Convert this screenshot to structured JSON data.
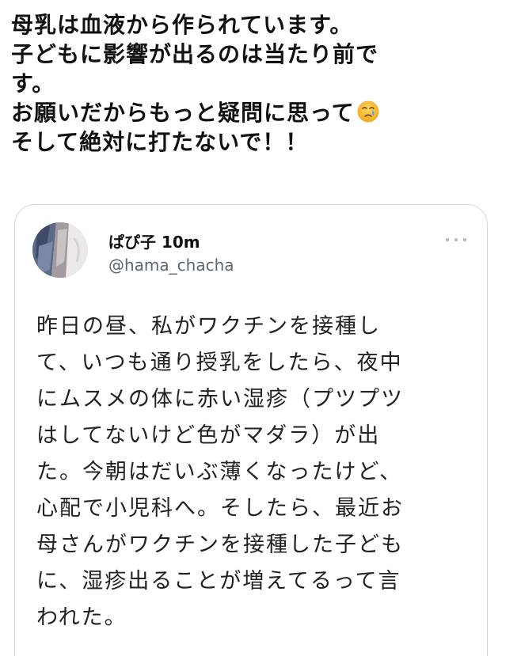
{
  "main_tweet": {
    "lines": [
      "母乳は血液から作られています。",
      "子どもに影響が出るのは当たり前で",
      "す。",
      "お願いだからもっと疑問に思って",
      "そして絶対に打たないで！！"
    ],
    "emoji": "crying-face-emoji"
  },
  "quote": {
    "author_name": "ぱぴ子 10m",
    "handle": "@hama_chacha",
    "lines": [
      "昨日の昼、私がワクチンを接種し",
      "て、いつも通り授乳をしたら、夜中",
      "にムスメの体に赤い湿疹（プツプツ",
      "はしてないけど色がマダラ）が出",
      "た。今朝はだいぶ薄くなったけど、",
      "心配で小児科へ。そしたら、最近お",
      "母さんがワクチンを接種した子ども",
      "に、湿疹出ることが増えてるって言",
      "われた。"
    ]
  },
  "colors": {
    "text": "#111111",
    "secondary_text": "#5b6670",
    "border": "#d3d8dc"
  }
}
